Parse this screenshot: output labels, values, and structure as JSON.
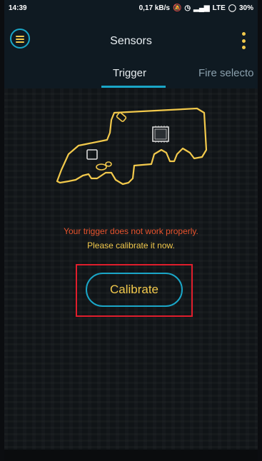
{
  "status_bar": {
    "time": "14:39",
    "speed": "0,17 kB/s",
    "network": "LTE",
    "battery": "30%"
  },
  "app_bar": {
    "title": "Sensors",
    "menu_icon": "hamburger-icon",
    "overflow_icon": "more-vert-icon"
  },
  "tabs": [
    {
      "label": "Trigger",
      "active": true
    },
    {
      "label": "Fire selecto",
      "active": false
    }
  ],
  "illustration": {
    "icon": "weapon-board-outline"
  },
  "message": {
    "line1": "Your trigger does not work properly.",
    "line2": "Please calibrate it now."
  },
  "actions": {
    "calibrate_label": "Calibrate"
  },
  "colors": {
    "accent": "#1aa6c7",
    "highlight": "#f2c94c",
    "error": "#e9542e",
    "annotation_box": "#e01e2c"
  }
}
